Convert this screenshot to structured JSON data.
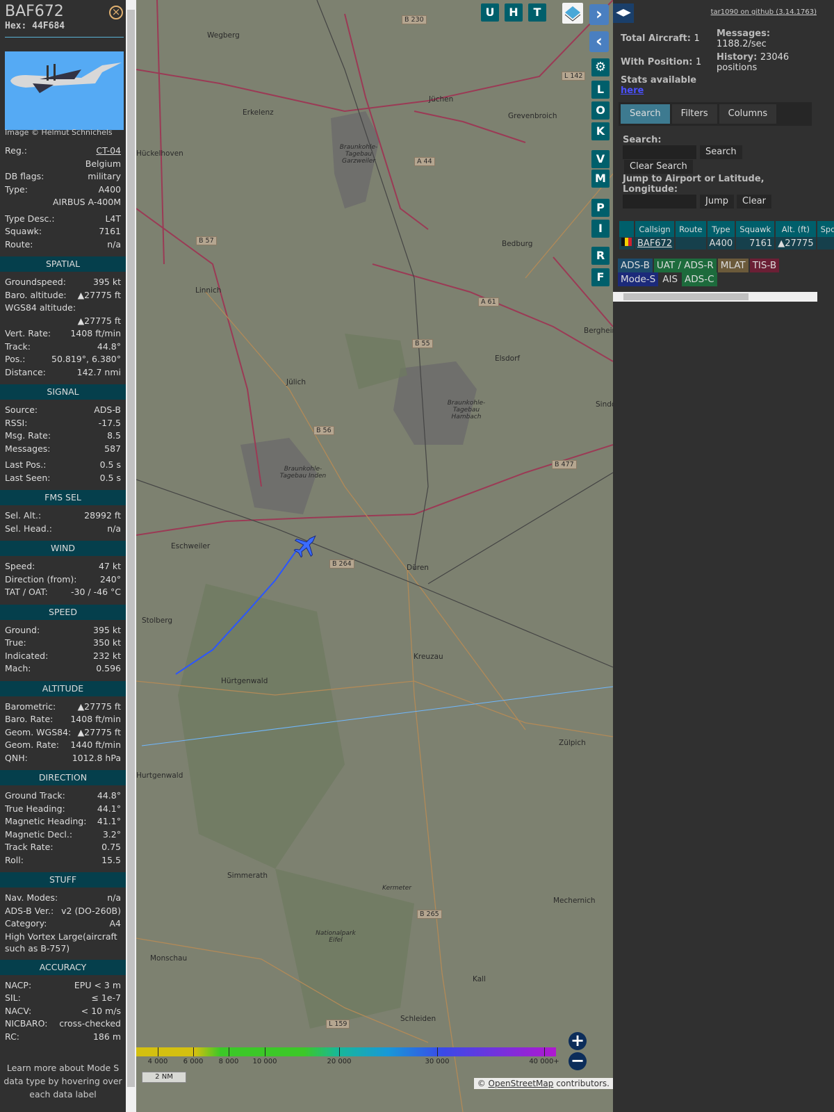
{
  "aircraft": {
    "callsign": "BAF672",
    "hex_label": "Hex:",
    "hex": "44F684",
    "image_credit": "Image © Helmut Schnichels"
  },
  "info": [
    {
      "k": "Reg.:",
      "v": "CT-04",
      "link": true
    },
    {
      "k": "",
      "v": "Belgium"
    },
    {
      "k": "DB flags:",
      "v": "military"
    },
    {
      "k": "Type:",
      "v": "A400"
    },
    {
      "k": "",
      "v": "AIRBUS A-400M"
    },
    {
      "gap": true
    },
    {
      "k": "Type Desc.:",
      "v": "L4T"
    },
    {
      "k": "Squawk:",
      "v": "7161"
    },
    {
      "k": "Route:",
      "v": "n/a"
    },
    {
      "sec": "SPATIAL"
    },
    {
      "k": "Groundspeed:",
      "v": "395 kt"
    },
    {
      "k": "Baro. altitude:",
      "v": "▲27775 ft"
    },
    {
      "k": "WGS84 altitude:",
      "v": ""
    },
    {
      "k": "",
      "v": "▲27775 ft"
    },
    {
      "k": "Vert. Rate:",
      "v": "1408 ft/min"
    },
    {
      "k": "Track:",
      "v": "44.8°"
    },
    {
      "k": "Pos.:",
      "v": "50.819°, 6.380°"
    },
    {
      "k": "Distance:",
      "v": "142.7 nmi"
    },
    {
      "sec": "SIGNAL"
    },
    {
      "k": "Source:",
      "v": "ADS-B"
    },
    {
      "k": "RSSI:",
      "v": "-17.5"
    },
    {
      "k": "Msg. Rate:",
      "v": "8.5"
    },
    {
      "k": "Messages:",
      "v": "587"
    },
    {
      "gap": true
    },
    {
      "k": "Last Pos.:",
      "v": "0.5 s"
    },
    {
      "k": "Last Seen:",
      "v": "0.5 s"
    },
    {
      "sec": "FMS SEL"
    },
    {
      "k": "Sel. Alt.:",
      "v": "28992 ft"
    },
    {
      "k": "Sel. Head.:",
      "v": "n/a"
    },
    {
      "sec": "WIND"
    },
    {
      "k": "Speed:",
      "v": "47 kt"
    },
    {
      "k": "Direction (from):",
      "v": "240°"
    },
    {
      "k": "TAT / OAT:",
      "v": "-30 / -46 °C"
    },
    {
      "sec": "SPEED"
    },
    {
      "k": "Ground:",
      "v": "395 kt"
    },
    {
      "k": "True:",
      "v": "350 kt"
    },
    {
      "k": "Indicated:",
      "v": "232 kt"
    },
    {
      "k": "Mach:",
      "v": "0.596"
    },
    {
      "sec": "ALTITUDE"
    },
    {
      "k": "Barometric:",
      "v": "▲27775 ft"
    },
    {
      "k": "Baro. Rate:",
      "v": "1408 ft/min"
    },
    {
      "k": "Geom. WGS84:",
      "v": "▲27775 ft"
    },
    {
      "k": "Geom. Rate:",
      "v": "1440 ft/min"
    },
    {
      "k": "QNH:",
      "v": "1012.8 hPa"
    },
    {
      "sec": "DIRECTION"
    },
    {
      "k": "Ground Track:",
      "v": "44.8°"
    },
    {
      "k": "True Heading:",
      "v": "44.1°"
    },
    {
      "k": "Magnetic Heading:",
      "v": "41.1°"
    },
    {
      "k": "Magnetic Decl.:",
      "v": "3.2°"
    },
    {
      "k": "Track Rate:",
      "v": "0.75"
    },
    {
      "k": "Roll:",
      "v": "15.5"
    },
    {
      "sec": "STUFF"
    },
    {
      "k": "Nav. Modes:",
      "v": "n/a"
    },
    {
      "k": "ADS-B Ver.:",
      "v": "v2 (DO-260B)"
    },
    {
      "k": "Category:",
      "v": "A4"
    },
    {
      "wrap": "High Vortex Large(aircraft such as B-757)"
    },
    {
      "sec": "ACCURACY"
    },
    {
      "k": "NACP:",
      "v": "EPU < 3 m"
    },
    {
      "k": "SIL:",
      "v": "≤ 1e-7"
    },
    {
      "k": "NACV:",
      "v": "< 10 m/s"
    },
    {
      "k": "NICBARO:",
      "v": "cross-checked"
    },
    {
      "k": "RC:",
      "v": "186 m"
    }
  ],
  "footer_text": "Learn more about Mode S data type by hovering over each data label",
  "map": {
    "top_buttons": [
      "U",
      "H",
      "T"
    ],
    "side_buttons": [
      "L",
      "O",
      "K",
      "V",
      "M",
      "P",
      "I",
      "R",
      "F"
    ],
    "labels": [
      "Wegberg",
      "Erkelenz",
      "Jüchen",
      "Grevenbroich",
      "Hückelhoven",
      "Linnich",
      "Bedburg",
      "Bergheim",
      "Elsdorf",
      "Jülich",
      "Sindorf",
      "Eschweiler",
      "Düren",
      "Stolberg",
      "Kreuzau",
      "Hürtgenwald",
      "Zülpich",
      "Hurtgenwald",
      "Simmerath",
      "Mechernich",
      "Monschau",
      "Kall",
      "Schleiden",
      "Braunkohle-Tagebau Garzweiler",
      "Braunkohle-Tagebau Hambach",
      "Braunkohle-Tagebau Inden",
      "Nationalpark Eifel",
      "Kermeter",
      "B 264",
      "B 56",
      "B 477",
      "A 61",
      "B 55",
      "A 44",
      "B 57",
      "L 142",
      "B 230",
      "L 159",
      "B 265"
    ],
    "altitude_scale": [
      "4 000",
      "6 000",
      "8 000",
      "10 000",
      "20 000",
      "30 000",
      "40 000+"
    ],
    "scale_label": "2 NM",
    "attribution_prefix": "© ",
    "attribution_link": "OpenStreetMap",
    "attribution_suffix": " contributors."
  },
  "right": {
    "github": "tar1090 on github (3.14.1763)",
    "total_aircraft": "Total Aircraft:",
    "total_aircraft_value": "1",
    "with_position": "With Position:",
    "with_position_value": "1",
    "messages": "Messages:",
    "messages_value": "1188.2/sec",
    "history": "History:",
    "history_value": "23046 positions",
    "stats": "Stats available",
    "stats_link": "here",
    "tabs": [
      "Search",
      "Filters",
      "Columns"
    ],
    "search_label": "Search:",
    "search_button": "Search",
    "clear_search": "Clear Search",
    "jump_label": "Jump to Airport or Latitude, Longitude:",
    "jump_button": "Jump",
    "clear_button": "Clear",
    "table": {
      "headers": [
        "",
        "Callsign",
        "Route",
        "Type",
        "Squawk",
        "Alt. (ft)",
        "Spd"
      ],
      "rows": [
        {
          "callsign": "BAF672",
          "route": "",
          "type": "A400",
          "squawk": "7161",
          "alt": "▲27775",
          "spd": ""
        }
      ]
    },
    "legend": [
      "ADS-B",
      "UAT / ADS-R",
      "MLAT",
      "TIS-B",
      "Mode-S",
      "AIS",
      "ADS-C"
    ],
    "legend_colors": [
      "#1c4a6a",
      "#1d6b3c",
      "#6b5a3a",
      "#6b1f35",
      "#1c2a7a",
      "#303030",
      "#1d6b3c"
    ]
  }
}
